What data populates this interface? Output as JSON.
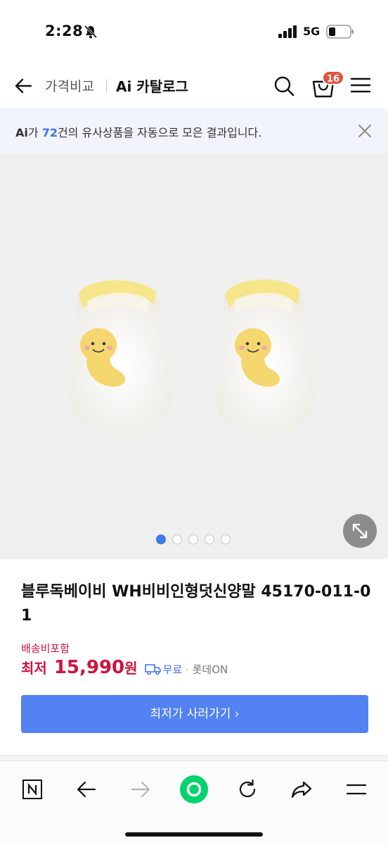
{
  "status_bar": {
    "time": "2:28",
    "network": "5G",
    "icons": [
      "bell-slash-icon",
      "signal-icon",
      "battery-icon"
    ]
  },
  "header": {
    "tabs": [
      "가격비교",
      "Ai 카탈로그"
    ],
    "cart_count": "16",
    "icons": [
      "back-arrow-icon",
      "search-icon",
      "cart-icon",
      "menu-icon"
    ]
  },
  "ai_banner": {
    "logo": "Ai",
    "text_before": "가 ",
    "count": "72",
    "text_after": "건의 유사상품을 자동으로 모은 결과입니다."
  },
  "gallery": {
    "dot_count": 5,
    "active_index": 0,
    "expand_icon": "expand-icon"
  },
  "product": {
    "title": "블루독베이비 WH비비인형덧신양말 45170-011-01",
    "shipping_note": "배송비포함",
    "price_prefix": "최저",
    "price": "15,990",
    "price_unit": "원",
    "shipping_fee": "무료",
    "separator": "·",
    "seller": "롯데ON",
    "cta_label": "최저가 사러가기 ›"
  },
  "browser_toolbar": {
    "icons": [
      "naver-n-icon",
      "back-icon",
      "forward-icon",
      "home-circle-icon",
      "refresh-icon",
      "share-icon",
      "menu-icon"
    ]
  },
  "colors": {
    "accent_blue": "#5382f2",
    "price_red": "#d1123e",
    "badge_red": "#e4523f",
    "naver_green": "#03d36c"
  }
}
